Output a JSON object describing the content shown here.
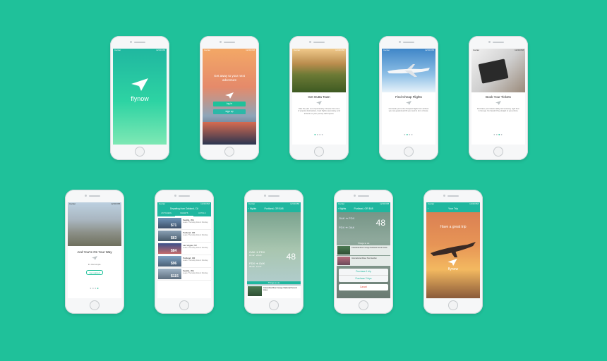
{
  "app": {
    "brand": "flynow",
    "colors": {
      "background": "#1fc19a",
      "accent": "#1fb79f",
      "danger": "#e24b3b"
    }
  },
  "statusbar": {
    "carrier": "Carrier",
    "time": "12:00 PM"
  },
  "screens": {
    "splash": {
      "brand": "flynow"
    },
    "login": {
      "headline": "Get away to your next adventure",
      "login_label": "log in",
      "signup_label": "sign up"
    },
    "onboarding": [
      {
        "title": "Get Outta Town",
        "body": "Take the pain out of spontaneity. Choose from tons of popular destinations, book flights seamlessly, and all book on your journey with Flynow."
      },
      {
        "title": "Find Cheap Flights",
        "body": "Get deals you're the cheapest flights from airlines you can guaranteed fill you need to do is choose."
      },
      {
        "title": "Book Your Tickets",
        "body": "Purchase your tickets safely and securely, right from in the app. No hassle! Pay straight to your phone."
      },
      {
        "title": "And You're On Your Way",
        "body": "It's that simple.",
        "cta": "Get started"
      }
    ],
    "results": {
      "header": "Departing from Oakland, CA",
      "tabs": [
        "ANYWHERE",
        "FLIGHTS",
        "HOTELS"
      ],
      "rows": [
        {
          "city": "Seattle, WA",
          "price": "$71"
        },
        {
          "city": "Portland, OR",
          "price": "$63"
        },
        {
          "city": "Las Vegas, NV",
          "price": "$84"
        },
        {
          "city": "Portland, OR",
          "price": "$96"
        },
        {
          "city": "Seattle, WA",
          "price": "$115"
        }
      ],
      "meta": "Leave Thursday  Return Monday"
    },
    "detail": {
      "header": "Portland, OR $48",
      "back": "flights",
      "out": {
        "from": "OAK",
        "to": "PDX",
        "dep": "16:42",
        "arr": "20:23"
      },
      "ret": {
        "from": "PDX",
        "to": "OAK",
        "dep": "09:30",
        "arr": "12:37"
      },
      "price": "48",
      "things_label": "Things to do",
      "place": "Columbia River Gorge National Scenic Area"
    },
    "purchase": {
      "header": "Portland, OR $48",
      "things_label": "Things to do",
      "places": [
        "Columbia River Gorge National Scenic Area",
        "International Rose Test Garden"
      ],
      "option1": "Purchase 1 trip",
      "option2": "Purchase 2 trips",
      "cancel": "Cancel"
    },
    "trip": {
      "header": "Your Trip",
      "message": "Have a great trip",
      "brand": "flynow"
    }
  }
}
